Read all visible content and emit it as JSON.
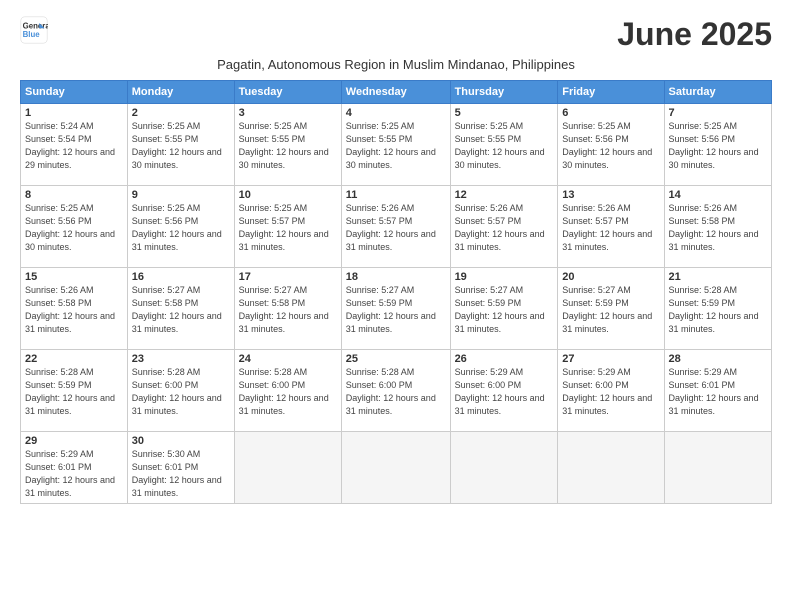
{
  "logo": {
    "line1": "General",
    "line2": "Blue"
  },
  "title": "June 2025",
  "subtitle": "Pagatin, Autonomous Region in Muslim Mindanao, Philippines",
  "days_of_week": [
    "Sunday",
    "Monday",
    "Tuesday",
    "Wednesday",
    "Thursday",
    "Friday",
    "Saturday"
  ],
  "weeks": [
    [
      {
        "day": "1",
        "sunrise": "5:24 AM",
        "sunset": "5:54 PM",
        "daylight": "12 hours and 29 minutes."
      },
      {
        "day": "2",
        "sunrise": "5:25 AM",
        "sunset": "5:55 PM",
        "daylight": "12 hours and 30 minutes."
      },
      {
        "day": "3",
        "sunrise": "5:25 AM",
        "sunset": "5:55 PM",
        "daylight": "12 hours and 30 minutes."
      },
      {
        "day": "4",
        "sunrise": "5:25 AM",
        "sunset": "5:55 PM",
        "daylight": "12 hours and 30 minutes."
      },
      {
        "day": "5",
        "sunrise": "5:25 AM",
        "sunset": "5:55 PM",
        "daylight": "12 hours and 30 minutes."
      },
      {
        "day": "6",
        "sunrise": "5:25 AM",
        "sunset": "5:56 PM",
        "daylight": "12 hours and 30 minutes."
      },
      {
        "day": "7",
        "sunrise": "5:25 AM",
        "sunset": "5:56 PM",
        "daylight": "12 hours and 30 minutes."
      }
    ],
    [
      {
        "day": "8",
        "sunrise": "5:25 AM",
        "sunset": "5:56 PM",
        "daylight": "12 hours and 30 minutes."
      },
      {
        "day": "9",
        "sunrise": "5:25 AM",
        "sunset": "5:56 PM",
        "daylight": "12 hours and 31 minutes."
      },
      {
        "day": "10",
        "sunrise": "5:25 AM",
        "sunset": "5:57 PM",
        "daylight": "12 hours and 31 minutes."
      },
      {
        "day": "11",
        "sunrise": "5:26 AM",
        "sunset": "5:57 PM",
        "daylight": "12 hours and 31 minutes."
      },
      {
        "day": "12",
        "sunrise": "5:26 AM",
        "sunset": "5:57 PM",
        "daylight": "12 hours and 31 minutes."
      },
      {
        "day": "13",
        "sunrise": "5:26 AM",
        "sunset": "5:57 PM",
        "daylight": "12 hours and 31 minutes."
      },
      {
        "day": "14",
        "sunrise": "5:26 AM",
        "sunset": "5:58 PM",
        "daylight": "12 hours and 31 minutes."
      }
    ],
    [
      {
        "day": "15",
        "sunrise": "5:26 AM",
        "sunset": "5:58 PM",
        "daylight": "12 hours and 31 minutes."
      },
      {
        "day": "16",
        "sunrise": "5:27 AM",
        "sunset": "5:58 PM",
        "daylight": "12 hours and 31 minutes."
      },
      {
        "day": "17",
        "sunrise": "5:27 AM",
        "sunset": "5:58 PM",
        "daylight": "12 hours and 31 minutes."
      },
      {
        "day": "18",
        "sunrise": "5:27 AM",
        "sunset": "5:59 PM",
        "daylight": "12 hours and 31 minutes."
      },
      {
        "day": "19",
        "sunrise": "5:27 AM",
        "sunset": "5:59 PM",
        "daylight": "12 hours and 31 minutes."
      },
      {
        "day": "20",
        "sunrise": "5:27 AM",
        "sunset": "5:59 PM",
        "daylight": "12 hours and 31 minutes."
      },
      {
        "day": "21",
        "sunrise": "5:28 AM",
        "sunset": "5:59 PM",
        "daylight": "12 hours and 31 minutes."
      }
    ],
    [
      {
        "day": "22",
        "sunrise": "5:28 AM",
        "sunset": "5:59 PM",
        "daylight": "12 hours and 31 minutes."
      },
      {
        "day": "23",
        "sunrise": "5:28 AM",
        "sunset": "6:00 PM",
        "daylight": "12 hours and 31 minutes."
      },
      {
        "day": "24",
        "sunrise": "5:28 AM",
        "sunset": "6:00 PM",
        "daylight": "12 hours and 31 minutes."
      },
      {
        "day": "25",
        "sunrise": "5:28 AM",
        "sunset": "6:00 PM",
        "daylight": "12 hours and 31 minutes."
      },
      {
        "day": "26",
        "sunrise": "5:29 AM",
        "sunset": "6:00 PM",
        "daylight": "12 hours and 31 minutes."
      },
      {
        "day": "27",
        "sunrise": "5:29 AM",
        "sunset": "6:00 PM",
        "daylight": "12 hours and 31 minutes."
      },
      {
        "day": "28",
        "sunrise": "5:29 AM",
        "sunset": "6:01 PM",
        "daylight": "12 hours and 31 minutes."
      }
    ],
    [
      {
        "day": "29",
        "sunrise": "5:29 AM",
        "sunset": "6:01 PM",
        "daylight": "12 hours and 31 minutes."
      },
      {
        "day": "30",
        "sunrise": "5:30 AM",
        "sunset": "6:01 PM",
        "daylight": "12 hours and 31 minutes."
      },
      null,
      null,
      null,
      null,
      null
    ]
  ]
}
